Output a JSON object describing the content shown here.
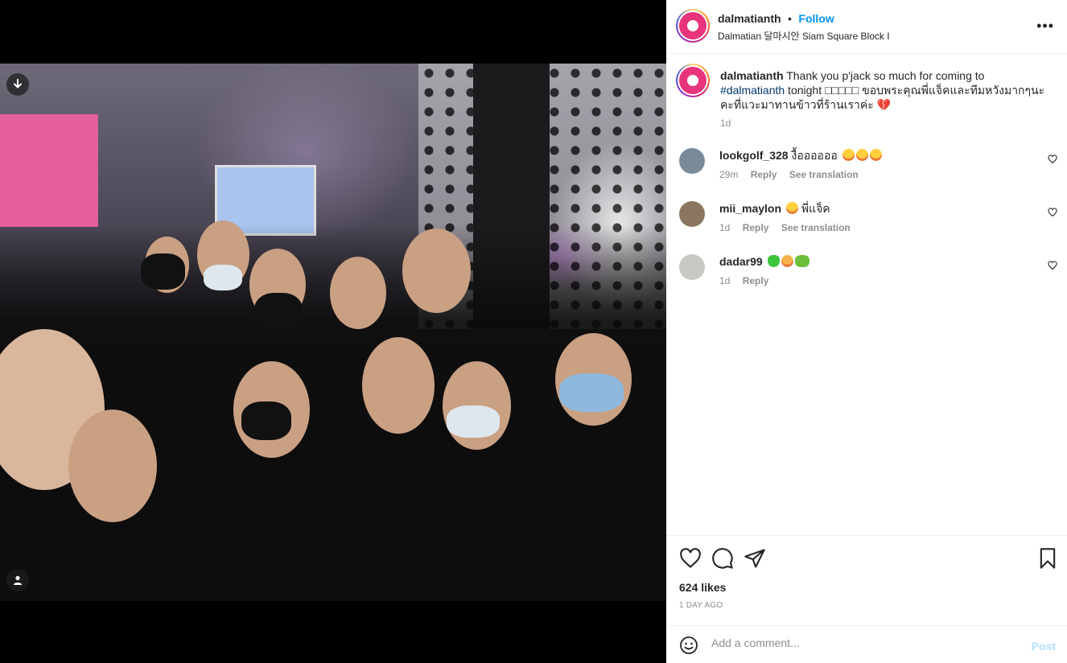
{
  "post": {
    "username": "dalmatianth",
    "separator": "•",
    "follow_label": "Follow",
    "location": "Dalmatian 달마시안 Siam Square Block I",
    "more_label": "•••"
  },
  "caption": {
    "username": "dalmatianth",
    "text_before": " Thank you p'jack so much for coming to ",
    "hashtag": "#dalmatianth",
    "text_after": " tonight □□□□□ ขอบพระคุณพี่แจ็คและทีมหวังมากๆนะคะที่แวะมาทานข้าวที่ร้านเราค่ะ 💔",
    "time": "1d"
  },
  "comments": [
    {
      "username": "lookgolf_328",
      "text": "งื้ออออออ",
      "time": "29m",
      "reply": "Reply",
      "translate": "See translation"
    },
    {
      "username": "mii_maylon",
      "text": "พี่แจ็ค",
      "time": "1d",
      "reply": "Reply",
      "translate": "See translation"
    },
    {
      "username": "dadar99",
      "text": "",
      "time": "1d",
      "reply": "Reply",
      "translate": ""
    }
  ],
  "actions": {
    "likes": "624 likes",
    "time_ago": "1 DAY AGO"
  },
  "add_comment": {
    "placeholder": "Add a comment...",
    "post_label": "Post"
  },
  "icons": {
    "download": "download-arrow-icon",
    "tag": "user-tag-icon",
    "like": "heart-icon",
    "comment": "comment-bubble-icon",
    "share": "paper-plane-icon",
    "save": "bookmark-icon",
    "emoji": "smiley-icon",
    "more": "more-horizontal-icon"
  },
  "colors": {
    "accent": "#0095f6",
    "hashtag": "#00376b",
    "post_disabled": "#b2dffc",
    "muted": "#8e8e8e"
  }
}
